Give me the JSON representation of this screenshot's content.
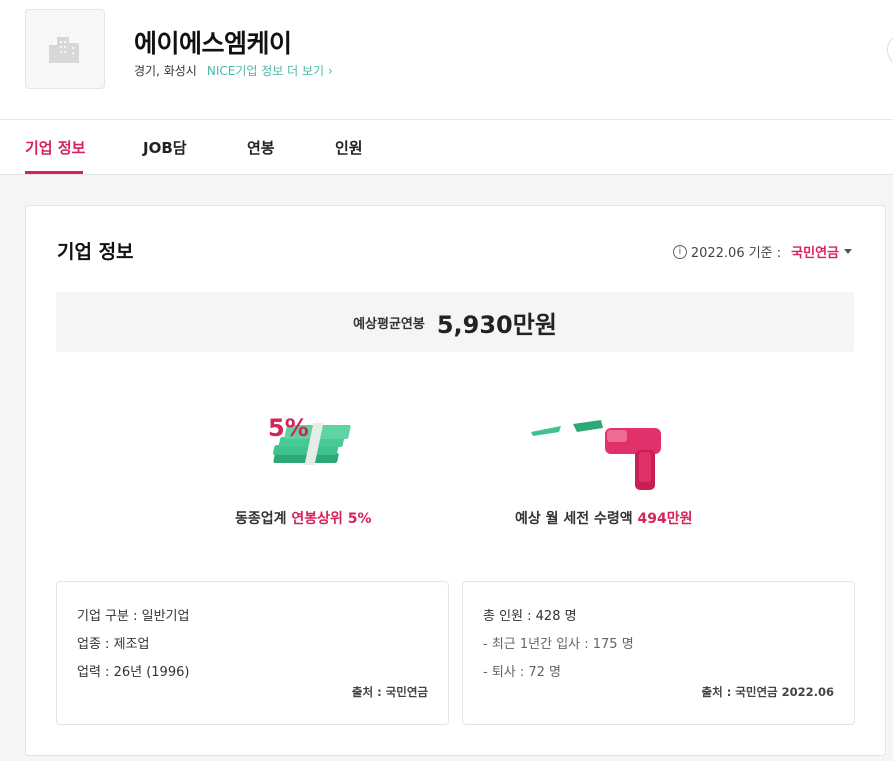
{
  "header": {
    "company_name": "에이에스엠케이",
    "location": "경기, 화성시",
    "nice_link": "NICE기업 정보 더 보기 ›"
  },
  "tabs": [
    {
      "label": "기업 정보",
      "active": true
    },
    {
      "label": "JOB담",
      "active": false
    },
    {
      "label": "연봉",
      "active": false
    },
    {
      "label": "인원",
      "active": false
    }
  ],
  "card": {
    "title": "기업 정보",
    "basis_date": "2022.06 기준 :",
    "source_selected": "국민연금",
    "salary_label": "예상평균연봉",
    "salary_value": "5,930만원",
    "feature_left": {
      "prefix": "동종업계 ",
      "highlight": "연봉상위 5%",
      "badge": "5%"
    },
    "feature_right": {
      "prefix": "예상 월 세전 수령액 ",
      "highlight": "494만원"
    },
    "company_box": {
      "lines": [
        "기업 구분 : 일반기업",
        "업종 : 제조업",
        "업력 : 26년 (1996)"
      ],
      "source": "출처 : 국민연금"
    },
    "staff_box": {
      "lines": [
        "총 인원 : 428 명",
        "-   최근 1년간 입사 : 175 명",
        "-   퇴사 : 72 명"
      ],
      "source": "출처 : 국민연금 2022.06"
    }
  },
  "colors": {
    "accent": "#d6245a",
    "nice_link": "#4cb8a8",
    "money_green": "#3fc28e"
  }
}
